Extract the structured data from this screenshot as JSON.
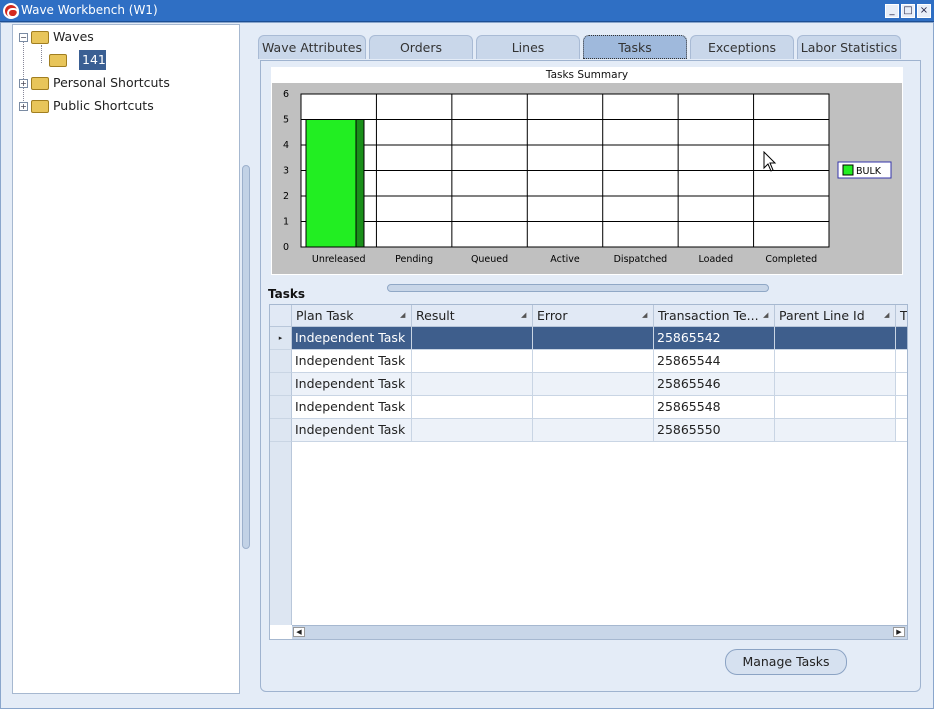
{
  "window": {
    "title": "Wave Workbench (W1)",
    "controls": [
      "_",
      "□",
      "×"
    ]
  },
  "nav": {
    "tree": [
      {
        "label": "Waves",
        "icon": "folder-icon"
      },
      {
        "label": "141",
        "icon": "folder-icon"
      },
      {
        "label": "Personal Shortcuts",
        "icon": "shortcut-folder-icon"
      },
      {
        "label": "Public Shortcuts",
        "icon": "shortcut-folder-icon"
      }
    ]
  },
  "tabs": [
    "Wave Attributes",
    "Orders",
    "Lines",
    "Tasks",
    "Exceptions",
    "Labor Statistics"
  ],
  "active_tab": "Tasks",
  "chart_data": {
    "type": "bar",
    "title": "Tasks Summary",
    "categories": [
      "Unreleased",
      "Pending",
      "Queued",
      "Active",
      "Dispatched",
      "Loaded",
      "Completed"
    ],
    "series": [
      {
        "name": "BULK",
        "values": [
          5,
          0,
          0,
          0,
          0,
          0,
          0
        ],
        "color": "#22ee22"
      }
    ],
    "ylim": [
      0,
      6
    ],
    "yticks": [
      "0",
      "1",
      "2",
      "3",
      "4",
      "5",
      "6"
    ],
    "grid": true,
    "legend": "right"
  },
  "tasks": {
    "label": "Tasks",
    "columns": [
      "Plan Task",
      "Result",
      "Error",
      "Transaction Te...",
      "Parent Line Id",
      "T"
    ],
    "rows": [
      {
        "plan_task": "Independent Task",
        "result": "",
        "error": "",
        "txn": "25865542",
        "parent": ""
      },
      {
        "plan_task": "Independent Task",
        "result": "",
        "error": "",
        "txn": "25865544",
        "parent": ""
      },
      {
        "plan_task": "Independent Task",
        "result": "",
        "error": "",
        "txn": "25865546",
        "parent": ""
      },
      {
        "plan_task": "Independent Task",
        "result": "",
        "error": "",
        "txn": "25865548",
        "parent": ""
      },
      {
        "plan_task": "Independent Task",
        "result": "",
        "error": "",
        "txn": "25865550",
        "parent": ""
      }
    ]
  },
  "buttons": {
    "manage_tasks": "Manage Tasks"
  }
}
